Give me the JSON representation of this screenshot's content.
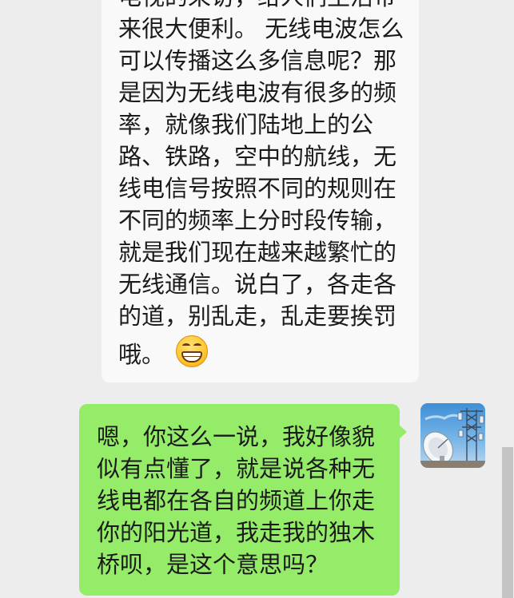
{
  "conversation": {
    "received_message": {
      "lines": [
        "电视的采访，给人们生活带",
        "来很大便利。 无线电波怎么",
        "可以传播这么多信息呢？那",
        "是因为无线电波有很多的频",
        "率，就像我们陆地上的公",
        "路、铁路，空中的航线，无",
        "线电信号按照不同的规则在",
        "不同的频率上分时段传输，",
        "就是我们现在越来越繁忙的",
        "无线通信。说白了，各走各",
        "的道，别乱走，乱走要挨罚",
        "哦。"
      ],
      "emoji": "grinning-face-icon"
    },
    "sent_message": {
      "lines": [
        "嗯，你这么一说，我好像貌",
        "似有点懂了，就是说各种无",
        "线电都在各自的频道上你走",
        "你的阳光道，我走我的独木",
        "桥呗，是这个意思吗？"
      ]
    },
    "avatar": {
      "icon": "satellite-dish-avatar-icon"
    }
  },
  "colors": {
    "background": "#EDEDED",
    "received_bubble": "#F9F9F9",
    "sent_bubble": "#95EC69",
    "text": "#1A1A1A",
    "scrollbar_thumb": "#C4C4C4"
  }
}
